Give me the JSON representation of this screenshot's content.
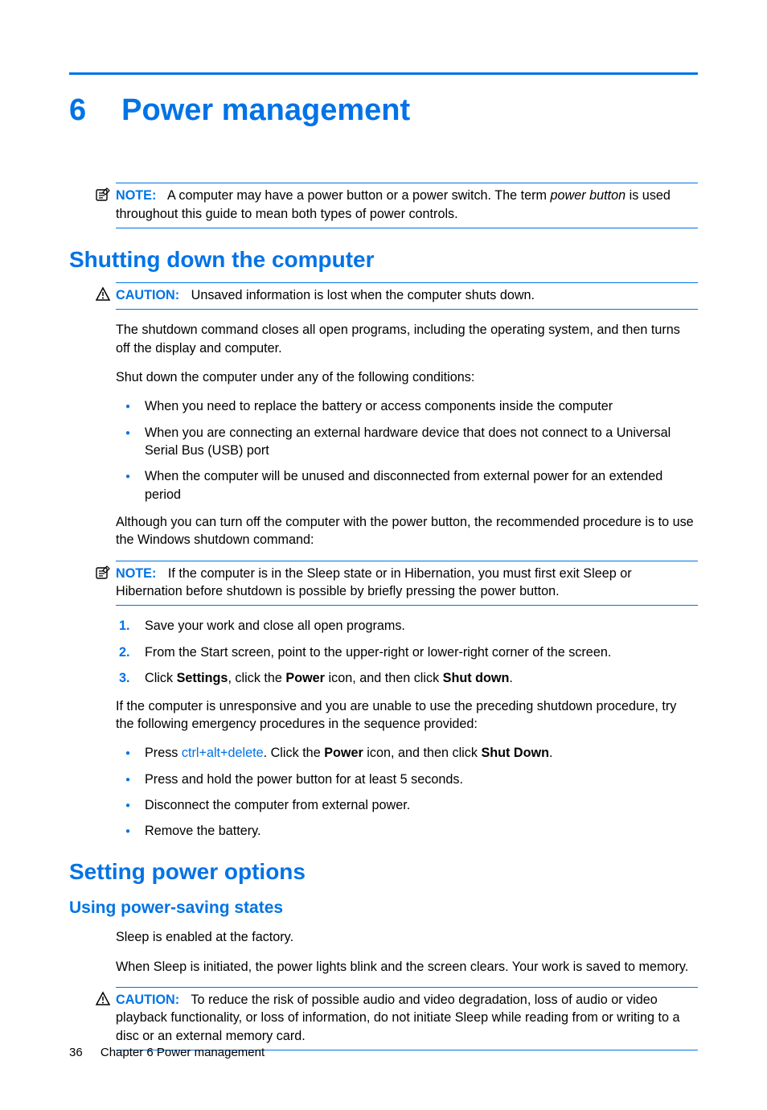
{
  "chapter": {
    "number": "6",
    "title": "Power management"
  },
  "note1": {
    "label": "NOTE:",
    "pre": "A computer may have a power button or a power switch. The term ",
    "italic": "power button",
    "post": " is used throughout this guide to mean both types of power controls."
  },
  "section1": {
    "title": "Shutting down the computer",
    "caution": {
      "label": "CAUTION:",
      "text": "Unsaved information is lost when the computer shuts down."
    },
    "para1": "The shutdown command closes all open programs, including the operating system, and then turns off the display and computer.",
    "para2": "Shut down the computer under any of the following conditions:",
    "bullets1": [
      "When you need to replace the battery or access components inside the computer",
      "When you are connecting an external hardware device that does not connect to a Universal Serial Bus (USB) port",
      "When the computer will be unused and disconnected from external power for an extended period"
    ],
    "para3": "Although you can turn off the computer with the power button, the recommended procedure is to use the Windows shutdown command:",
    "note2": {
      "label": "NOTE:",
      "text": "If the computer is in the Sleep state or in Hibernation, you must first exit Sleep or Hibernation before shutdown is possible by briefly pressing the power button."
    },
    "steps": {
      "s1": "Save your work and close all open programs.",
      "s2": "From the Start screen, point to the upper-right or lower-right corner of the screen.",
      "s3_pre": "Click ",
      "s3_b1": "Settings",
      "s3_mid1": ", click the ",
      "s3_b2": "Power",
      "s3_mid2": " icon, and then click ",
      "s3_b3": "Shut down",
      "s3_post": "."
    },
    "para4": "If the computer is unresponsive and you are unable to use the preceding shutdown procedure, try the following emergency procedures in the sequence provided:",
    "bullets2": {
      "b1_pre": "Press ",
      "b1_k1": "ctrl",
      "b1_plus": "+",
      "b1_k2": "alt",
      "b1_k3": "delete",
      "b1_mid": ". Click the ",
      "b1_b1": "Power",
      "b1_mid2": " icon, and then click ",
      "b1_b2": "Shut Down",
      "b1_post": ".",
      "b2": "Press and hold the power button for at least 5 seconds.",
      "b3": "Disconnect the computer from external power.",
      "b4": "Remove the battery."
    }
  },
  "section2": {
    "title": "Setting power options",
    "sub1": {
      "title": "Using power-saving states",
      "para1": "Sleep is enabled at the factory.",
      "para2": "When Sleep is initiated, the power lights blink and the screen clears. Your work is saved to memory.",
      "caution": {
        "label": "CAUTION:",
        "text": "To reduce the risk of possible audio and video degradation, loss of audio or video playback functionality, or loss of information, do not initiate Sleep while reading from or writing to a disc or an external memory card."
      }
    }
  },
  "footer": {
    "page_number": "36",
    "chapter_label": "Chapter 6   Power management"
  }
}
